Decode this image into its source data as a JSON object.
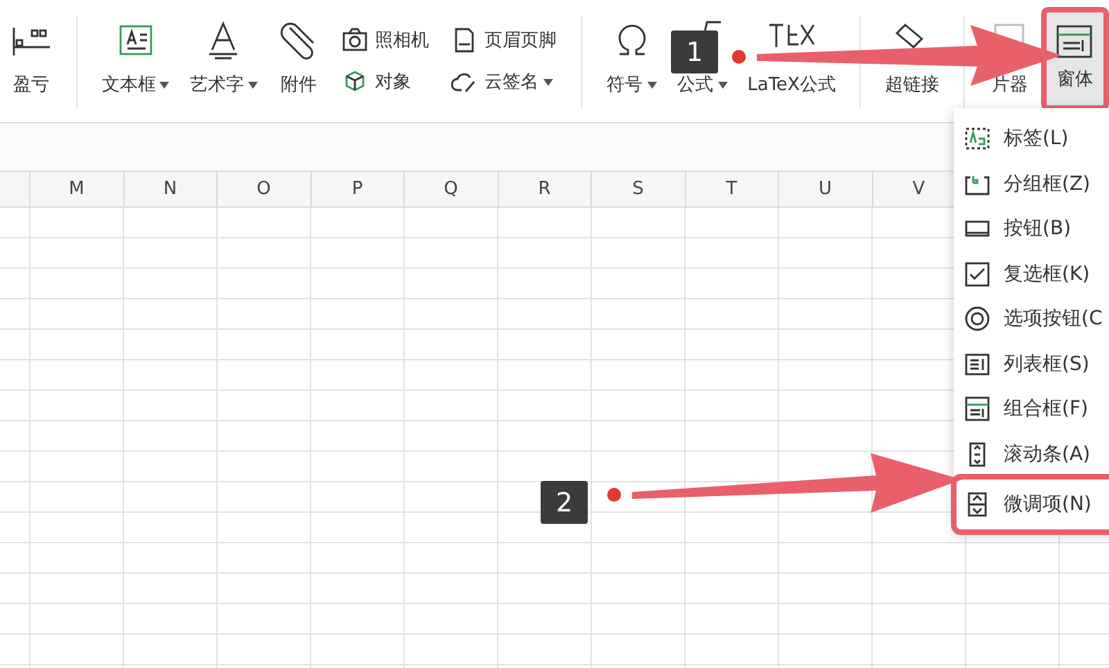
{
  "toolbar": {
    "items": [
      {
        "kind": "big",
        "label": "盈亏",
        "dropdown": false,
        "separator_after": true
      },
      {
        "kind": "big",
        "label": "文本框",
        "dropdown": true,
        "separator_after": false
      },
      {
        "kind": "big",
        "label": "艺术字",
        "dropdown": true,
        "separator_after": false
      },
      {
        "kind": "big",
        "label": "附件",
        "dropdown": false,
        "separator_after": false
      },
      {
        "kind": "pair",
        "top": {
          "label": "照相机",
          "dropdown": false
        },
        "bottom": {
          "label": "对象",
          "dropdown": false
        },
        "separator_after": false
      },
      {
        "kind": "pair",
        "top": {
          "label": "页眉页脚",
          "dropdown": false
        },
        "bottom": {
          "label": "云签名",
          "dropdown": true
        },
        "separator_after": true
      },
      {
        "kind": "big",
        "label": "符号",
        "dropdown": true,
        "separator_after": false
      },
      {
        "kind": "big",
        "label": "公式",
        "dropdown": true,
        "separator_after": false
      },
      {
        "kind": "big",
        "label": "LaTeX公式",
        "dropdown": false,
        "separator_after": true
      },
      {
        "kind": "big",
        "label": "超链接",
        "dropdown": false,
        "separator_after": true
      },
      {
        "kind": "big",
        "label": "片器",
        "dropdown": false,
        "separator_after": false
      },
      {
        "kind": "big",
        "label": "窗体",
        "dropdown": false,
        "selected": true,
        "separator_after": false
      }
    ]
  },
  "sheet": {
    "columns": [
      "M",
      "N",
      "O",
      "P",
      "Q",
      "R",
      "S",
      "T",
      "U",
      "V"
    ]
  },
  "form_menu": {
    "items": [
      {
        "kind": "label",
        "label": "标签(L)",
        "highlighted": false
      },
      {
        "kind": "groupbox",
        "label": "分组框(Z)",
        "highlighted": false
      },
      {
        "kind": "button",
        "label": "按钮(B)",
        "highlighted": false
      },
      {
        "kind": "checkbox",
        "label": "复选框(K)",
        "highlighted": false
      },
      {
        "kind": "radio",
        "label": "选项按钮(C",
        "highlighted": false
      },
      {
        "kind": "listbox",
        "label": "列表框(S)",
        "highlighted": false
      },
      {
        "kind": "combobox",
        "label": "组合框(F)",
        "highlighted": false
      },
      {
        "kind": "scrollbar",
        "label": "滚动条(A)",
        "highlighted": false
      },
      {
        "kind": "spinner",
        "label": "微调项(N)",
        "highlighted": true
      }
    ]
  },
  "callouts": [
    {
      "label": "1"
    },
    {
      "label": "2"
    }
  ]
}
